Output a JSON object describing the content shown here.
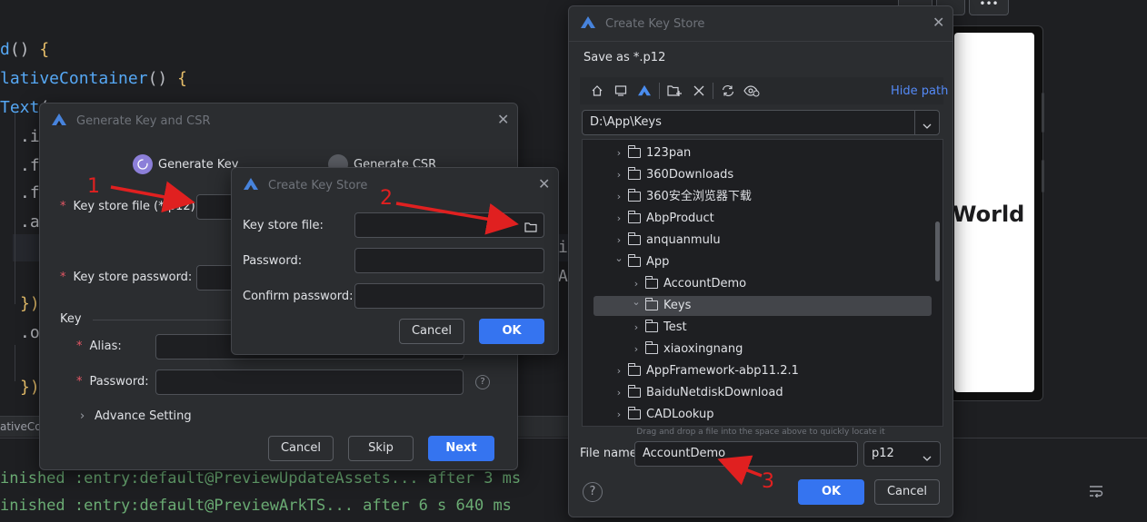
{
  "editor": {
    "code_lines": [
      {
        "prefix": "d",
        "paren": "() ",
        "brace": "{"
      },
      {
        "prefix": "lativeContainer",
        "paren": "() ",
        "brace": "{"
      },
      {
        "prefix": "Text",
        "paren": "(",
        "brace": ""
      }
    ],
    "method_fragments": [
      ".i",
      ".f",
      ".f",
      ".a"
    ],
    "closing_fragments": [
      "})",
      ".o",
      "})"
    ],
    "side_fragments": [
      "i",
      "A"
    ],
    "breadcrumb": "ativeConta",
    "console_lines": [
      "inished :entry:default@PreviewUpdateAssets... after 3 ms",
      "inished :entry:default@PreviewArkTS... after 6 s 640 ms"
    ]
  },
  "preview": {
    "text": "World"
  },
  "generate_dialog": {
    "title": "Generate Key and CSR",
    "steps": [
      "Generate Key",
      "Generate CSR"
    ],
    "key_store_file_label": "Key store file (*.p12):",
    "key_store_password_label": "Key store password:",
    "key_section_label": "Key",
    "alias_label": "Alias:",
    "password_label": "Password:",
    "help_icon_text": "?",
    "advance_setting_label": "Advance Setting",
    "buttons": {
      "cancel": "Cancel",
      "skip": "Skip",
      "next": "Next"
    },
    "required_mark": "*"
  },
  "create_dialog_small": {
    "title": "Create Key Store",
    "key_store_file_label": "Key store file:",
    "password_label": "Password:",
    "confirm_password_label": "Confirm password:",
    "buttons": {
      "cancel": "Cancel",
      "ok": "OK"
    }
  },
  "create_dialog_large": {
    "title": "Create Key Store",
    "subtitle": "Save as *.p12",
    "hide_path_label": "Hide path",
    "path_value": "D:\\App\\Keys",
    "toolbar_icons": [
      "home-icon",
      "desktop-icon",
      "project-icon",
      "new-folder-icon",
      "delete-icon",
      "refresh-icon",
      "show-hidden-icon"
    ],
    "tree": [
      {
        "label": "123pan",
        "depth": 0,
        "expanded": false,
        "selected": false
      },
      {
        "label": "360Downloads",
        "depth": 0,
        "expanded": false,
        "selected": false
      },
      {
        "label": "360安全浏览器下载",
        "depth": 0,
        "expanded": false,
        "selected": false
      },
      {
        "label": "AbpProduct",
        "depth": 0,
        "expanded": false,
        "selected": false
      },
      {
        "label": "anquanmulu",
        "depth": 0,
        "expanded": false,
        "selected": false
      },
      {
        "label": "App",
        "depth": 0,
        "expanded": true,
        "selected": false
      },
      {
        "label": "AccountDemo",
        "depth": 1,
        "expanded": false,
        "selected": false
      },
      {
        "label": "Keys",
        "depth": 1,
        "expanded": true,
        "selected": true
      },
      {
        "label": "Test",
        "depth": 1,
        "expanded": false,
        "selected": false
      },
      {
        "label": "xiaoxingnang",
        "depth": 1,
        "expanded": false,
        "selected": false
      },
      {
        "label": "AppFramework-abp11.2.1",
        "depth": 0,
        "expanded": false,
        "selected": false
      },
      {
        "label": "BaiduNetdiskDownload",
        "depth": 0,
        "expanded": false,
        "selected": false
      },
      {
        "label": "CADLookup",
        "depth": 0,
        "expanded": false,
        "selected": false
      }
    ],
    "drag_hint": "Drag and drop a file into the space above to quickly locate it",
    "file_name_label": "File name:",
    "file_name_value": "AccountDemo",
    "extension_value": "p12",
    "help_icon_text": "?",
    "buttons": {
      "ok": "OK",
      "cancel": "Cancel"
    }
  },
  "annotations": [
    "1",
    "2",
    "3"
  ],
  "colors": {
    "accent": "#3574f0",
    "annotation": "#e02020",
    "dialog_bg": "#2b2d30",
    "editor_bg": "#1e1f22"
  }
}
